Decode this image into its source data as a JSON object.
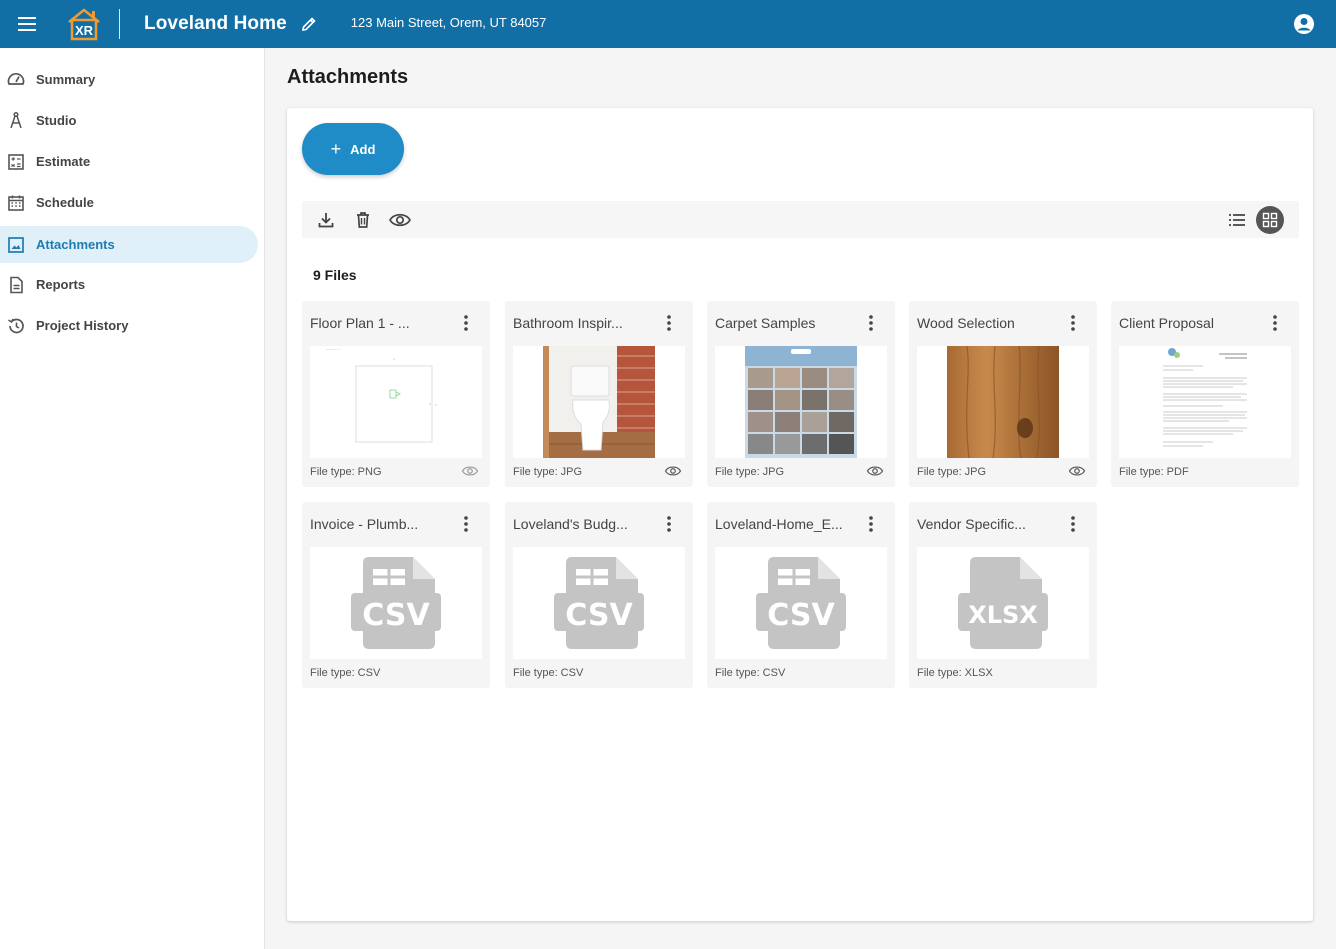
{
  "header": {
    "logo_text": "XR",
    "project_title": "Loveland Home",
    "address": "123 Main Street, Orem, UT 84057",
    "colors": {
      "bar": "#126fa6",
      "logo_orange": "#f29a2e"
    }
  },
  "sidebar": {
    "items": [
      {
        "label": "Summary",
        "icon": "speedometer-icon",
        "active": false
      },
      {
        "label": "Studio",
        "icon": "compass-icon",
        "active": false
      },
      {
        "label": "Estimate",
        "icon": "calculator-icon",
        "active": false
      },
      {
        "label": "Schedule",
        "icon": "calendar-icon",
        "active": false
      },
      {
        "label": "Attachments",
        "icon": "image-icon",
        "active": true
      },
      {
        "label": "Reports",
        "icon": "document-icon",
        "active": false
      },
      {
        "label": "Project History",
        "icon": "history-icon",
        "active": false
      }
    ],
    "active_color": "#1f7bb0",
    "active_bg": "#dff0f8"
  },
  "main": {
    "title": "Attachments",
    "add_label": "Add",
    "file_count": "9 Files",
    "view_mode": "grid",
    "files": [
      {
        "name": "Floor Plan 1 - ...",
        "type": "File type: PNG",
        "thumb": "floorplan",
        "previewable": true
      },
      {
        "name": "Bathroom Inspir...",
        "type": "File type: JPG",
        "thumb": "bathroom",
        "previewable": true
      },
      {
        "name": "Carpet Samples",
        "type": "File type: JPG",
        "thumb": "carpet",
        "previewable": true
      },
      {
        "name": "Wood Selection",
        "type": "File type: JPG",
        "thumb": "wood",
        "previewable": true
      },
      {
        "name": "Client Proposal",
        "type": "File type: PDF",
        "thumb": "pdf",
        "previewable": false
      },
      {
        "name": "Invoice - Plumb...",
        "type": "File type: CSV",
        "thumb": "CSV",
        "previewable": false
      },
      {
        "name": "Loveland's Budg...",
        "type": "File type: CSV",
        "thumb": "CSV",
        "previewable": false
      },
      {
        "name": "Loveland-Home_E...",
        "type": "File type: CSV",
        "thumb": "CSV",
        "previewable": false
      },
      {
        "name": "Vendor Specific...",
        "type": "File type: XLSX",
        "thumb": "XLSX",
        "previewable": false
      }
    ]
  }
}
